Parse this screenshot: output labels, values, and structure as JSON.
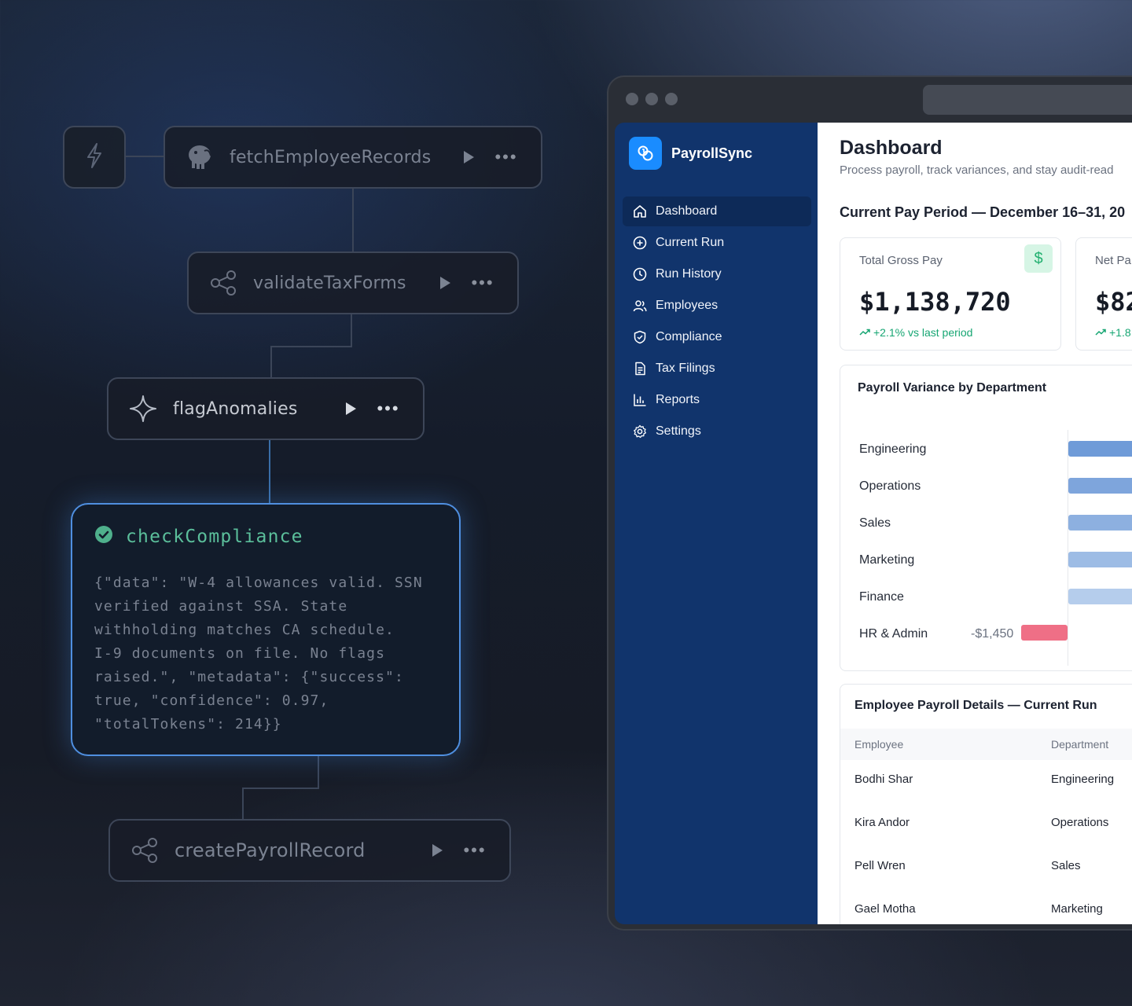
{
  "workflow": {
    "nodes": [
      {
        "label": "fetchEmployeeRecords",
        "icon": "database-elephant-icon"
      },
      {
        "label": "validateTaxForms",
        "icon": "share-nodes-icon"
      },
      {
        "label": "flagAnomalies",
        "icon": "sparkle-icon"
      },
      {
        "label": "createPayrollRecord",
        "icon": "share-nodes-icon"
      }
    ],
    "compliance": {
      "title": "checkCompliance",
      "status_icon": "check-circle-icon",
      "output": "{\"data\": \"W-4 allowances valid. SSN\nverified against SSA. State\nwithholding matches CA schedule.\nI-9 documents on file. No flags\nraised.\", \"metadata\": {\"success\":\ntrue, \"confidence\": 0.97,\n\"totalTokens\": 214}}"
    }
  },
  "app": {
    "brand": "PayrollSync",
    "nav": [
      {
        "label": "Dashboard",
        "icon": "home-icon",
        "active": true
      },
      {
        "label": "Current Run",
        "icon": "plus-circle-icon"
      },
      {
        "label": "Run History",
        "icon": "clock-icon"
      },
      {
        "label": "Employees",
        "icon": "users-icon"
      },
      {
        "label": "Compliance",
        "icon": "shield-check-icon"
      },
      {
        "label": "Tax Filings",
        "icon": "document-icon"
      },
      {
        "label": "Reports",
        "icon": "bar-chart-icon"
      },
      {
        "label": "Settings",
        "icon": "gear-icon"
      }
    ],
    "header": {
      "title": "Dashboard",
      "subtitle": "Process payroll, track variances, and stay audit-read",
      "period": "Current Pay Period — December 16–31, 20"
    },
    "kpis": [
      {
        "label": "Total Gross Pay",
        "value": "$1,138,720",
        "delta": "+2.1% vs last period",
        "badge": "$"
      },
      {
        "label": "Net Pa",
        "value": "$82",
        "delta": "+1.8"
      }
    ],
    "variance": {
      "title": "Payroll Variance by Department",
      "hr_value_label": "-$1,450"
    },
    "table": {
      "title": "Employee Payroll Details — Current Run",
      "columns": [
        "Employee",
        "Department"
      ],
      "rows": [
        [
          "Bodhi Shar",
          "Engineering"
        ],
        [
          "Kira Andor",
          "Operations"
        ],
        [
          "Pell Wren",
          "Sales"
        ],
        [
          "Gael Motha",
          "Marketing"
        ]
      ]
    }
  },
  "chart_data": {
    "type": "bar",
    "title": "Payroll Variance by Department",
    "categories": [
      "Engineering",
      "Operations",
      "Sales",
      "Marketing",
      "Finance",
      "HR & Admin"
    ],
    "values": [
      null,
      null,
      null,
      null,
      null,
      -1450
    ],
    "colors": [
      "#6f9bd8",
      "#7ea5dc",
      "#8db0e0",
      "#9dbce5",
      "#b5cdec",
      "#ef6f86"
    ],
    "note_visible": "positive bars extend past the visible crop"
  }
}
